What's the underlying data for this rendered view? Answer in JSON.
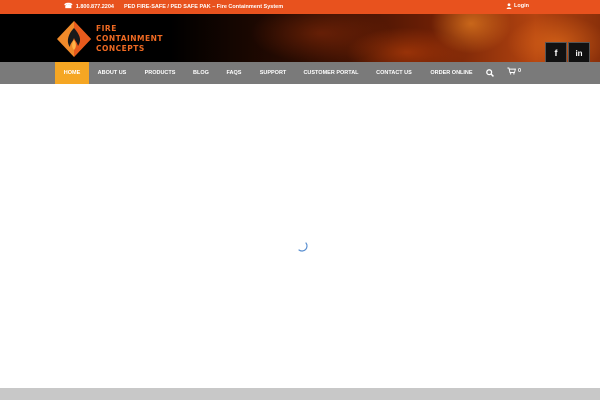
{
  "topbar": {
    "phone": "1.800.877.2204",
    "tagline": "PED FIRE-SAFE / PED SAFE PAK – Fire Containment System",
    "login_label": "Login",
    "bg_color": "#e8521e"
  },
  "logo": {
    "line1": "FIRE",
    "line2": "CONTAINMENT",
    "line3": "CONCEPTS",
    "color": "#f06a22"
  },
  "social": {
    "facebook_label": "f",
    "linkedin_label": "in"
  },
  "nav": {
    "items": [
      {
        "label": "HOME",
        "active": true
      },
      {
        "label": "ABOUT US"
      },
      {
        "label": "PRODUCTS"
      },
      {
        "label": "BLOG"
      },
      {
        "label": "FAQS"
      },
      {
        "label": "SUPPORT"
      },
      {
        "label": "CUSTOMER PORTAL"
      },
      {
        "label": "CONTACT US"
      },
      {
        "label": "ORDER ONLINE"
      }
    ],
    "cart_count": "0",
    "active_color": "#f5a623",
    "bg_color": "#7a7a7a"
  },
  "icons": [
    "phone-icon",
    "user-icon",
    "search-icon",
    "cart-icon",
    "spinner-icon"
  ]
}
